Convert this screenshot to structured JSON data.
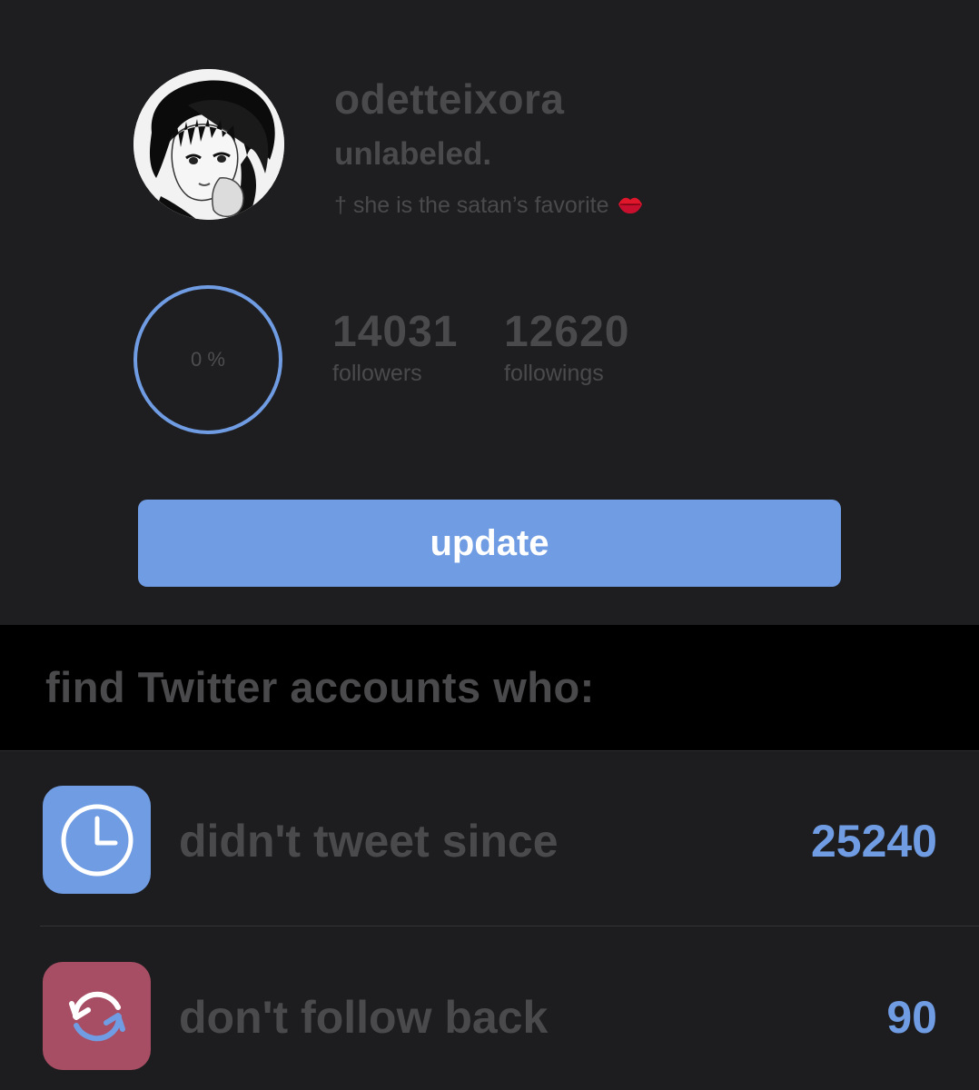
{
  "profile": {
    "username": "odetteixora",
    "display_name": "unlabeled.",
    "bio": "† she is the satan’s favorite",
    "bio_emoji_icon": "kiss-mark-icon"
  },
  "progress": {
    "label": "0 %",
    "value": 0,
    "color": "#6f9ce2"
  },
  "stats": {
    "followers": {
      "value": "14031",
      "label": "followers"
    },
    "followings": {
      "value": "12620",
      "label": "followings"
    }
  },
  "update_button": {
    "label": "update",
    "color": "#6f9ce2"
  },
  "section": {
    "title": "find Twitter accounts who:"
  },
  "list": [
    {
      "label": "didn't tweet since",
      "count": "25240",
      "icon": "clock-icon",
      "icon_color": "#6f9ce2"
    },
    {
      "label": "don't follow back",
      "count": "90",
      "icon": "refresh-arrows-icon",
      "icon_color": "#a84e64"
    }
  ]
}
